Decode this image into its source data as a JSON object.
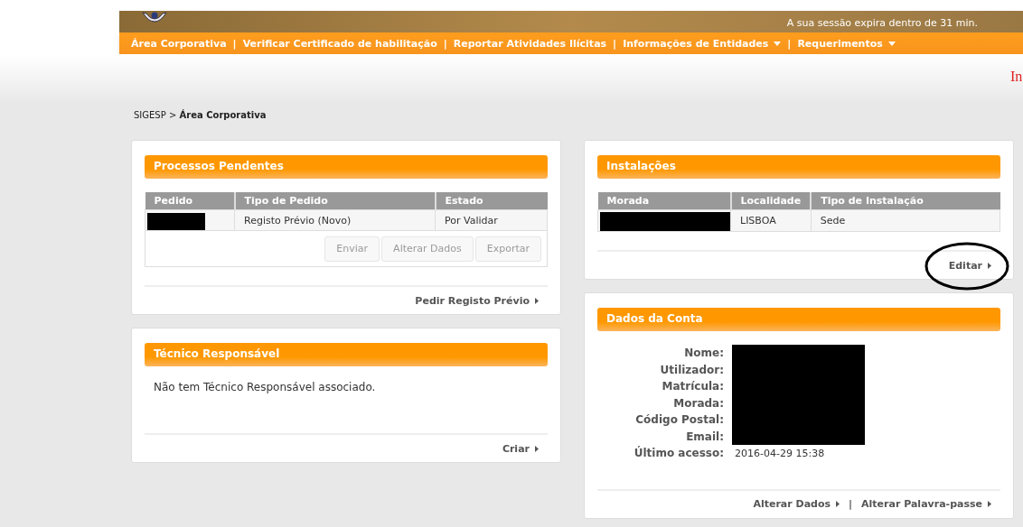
{
  "header": {
    "session_notice": "A sua sessão expira dentro de 31 min."
  },
  "nav": [
    {
      "kind": "link",
      "label": "Área Corporativa",
      "dropdown": false
    },
    {
      "kind": "separator",
      "label": "|"
    },
    {
      "kind": "link",
      "label": "Verificar Certificado de habilitação",
      "dropdown": false
    },
    {
      "kind": "separator",
      "label": "|"
    },
    {
      "kind": "link",
      "label": "Reportar Atividades Ilícitas",
      "dropdown": false
    },
    {
      "kind": "separator",
      "label": "|"
    },
    {
      "kind": "link",
      "label": "Informações de Entidades",
      "dropdown": true
    },
    {
      "kind": "separator",
      "label": "|"
    },
    {
      "kind": "link",
      "label": "Requerimentos",
      "dropdown": true
    }
  ],
  "edge_text": "In",
  "breadcrumb": "SIGESP > **Área Corporativa**",
  "processos": {
    "title": "Processos Pendentes",
    "columns": [
      "Pedido",
      "Tipo de Pedido",
      "Estado"
    ],
    "rows": [
      {
        "cells": [
          {
            "redacted": true
          },
          {
            "redacted": false,
            "text": "Registo Prévio (Novo)"
          },
          {
            "redacted": false,
            "text": "Por Validar"
          }
        ]
      }
    ],
    "buttons": [
      {
        "label": "Enviar",
        "disabled": true
      },
      {
        "label": "Alterar Dados",
        "disabled": true
      },
      {
        "label": "Exportar",
        "disabled": true
      }
    ],
    "footer_links": [
      {
        "kind": "link",
        "label": "Pedir Registo Prévio"
      }
    ]
  },
  "tecnico": {
    "title": "Técnico Responsável",
    "message": "Não tem Técnico Responsável associado.",
    "footer_links": [
      {
        "kind": "link",
        "label": "Criar"
      }
    ]
  },
  "instalacoes": {
    "title": "Instalações",
    "columns": [
      "Morada",
      "Localidade",
      "Tipo de Instalação"
    ],
    "rows": [
      {
        "cells": [
          {
            "redacted": true
          },
          {
            "redacted": false,
            "text": "LISBOA"
          },
          {
            "redacted": false,
            "text": "Sede"
          }
        ]
      }
    ],
    "footer_links": [
      {
        "kind": "link",
        "label": "Editar",
        "annotated": true
      }
    ]
  },
  "conta": {
    "title": "Dados da Conta",
    "fields": [
      {
        "label": "Nome:",
        "redacted": true
      },
      {
        "label": "Utilizador:",
        "redacted": true
      },
      {
        "label": "Matrícula:",
        "redacted": true
      },
      {
        "label": "Morada:",
        "redacted": true
      },
      {
        "label": "Código Postal:",
        "redacted": true
      },
      {
        "label": "Email:",
        "redacted": true
      },
      {
        "label": "Último acesso:",
        "redacted": false,
        "value": "2016-04-29 15:38"
      }
    ],
    "footer_links": [
      {
        "kind": "link",
        "label": "Alterar Dados"
      },
      {
        "kind": "separator",
        "label": "|"
      },
      {
        "kind": "link",
        "label": "Alterar Palavra-passe"
      }
    ]
  }
}
